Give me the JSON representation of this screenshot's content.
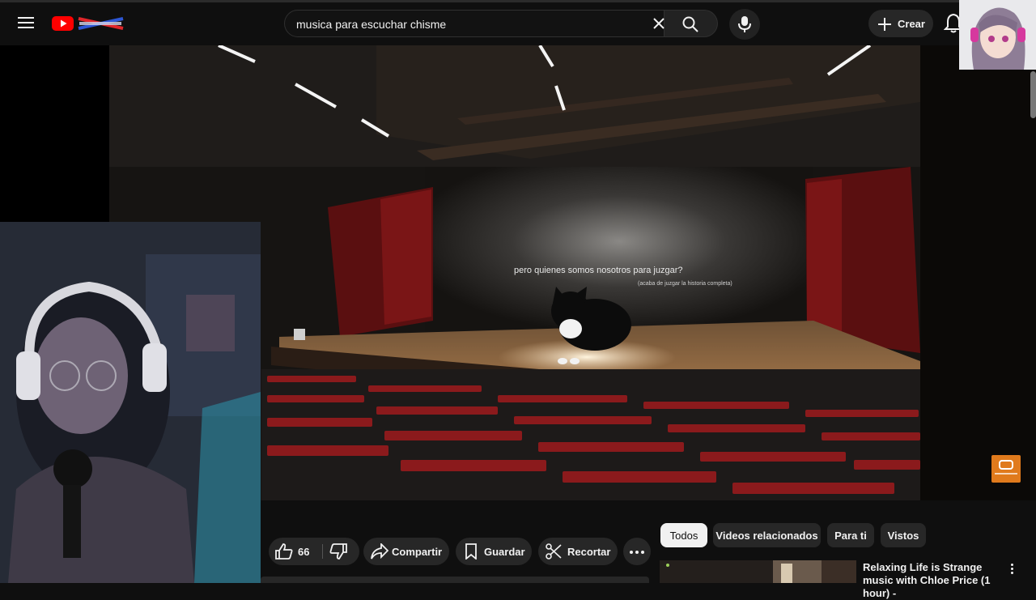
{
  "header": {
    "search_query": "musica para escuchar chisme",
    "create_label": "Crear"
  },
  "video": {
    "subtitle_main": "pero quienes somos nosotros para juzgar?",
    "subtitle_note": "(acaba de juzgar la historia completa)"
  },
  "actions": {
    "like_count": "66",
    "share_label": "Compartir",
    "save_label": "Guardar",
    "clip_label": "Recortar"
  },
  "chips": [
    "Todos",
    "Videos relacionados",
    "Para ti",
    "Vistos"
  ],
  "related": [
    {
      "title": "Relaxing Life is Strange music with Chloe Price (1 hour) -"
    }
  ],
  "icons": {
    "menu": "menu-icon",
    "search": "search-icon",
    "clear": "close-icon",
    "mic": "mic-icon",
    "create": "plus-icon",
    "bell": "bell-icon",
    "like": "thumbs-up-icon",
    "dislike": "thumbs-down-icon",
    "share": "share-icon",
    "save": "bookmark-icon",
    "clip": "scissors-icon",
    "more": "more-horizontal-icon"
  },
  "colors": {
    "background": "#0f0f0f",
    "pill": "#272727",
    "brand_red": "#ff0000",
    "chip_active": "#f1f1f1"
  }
}
